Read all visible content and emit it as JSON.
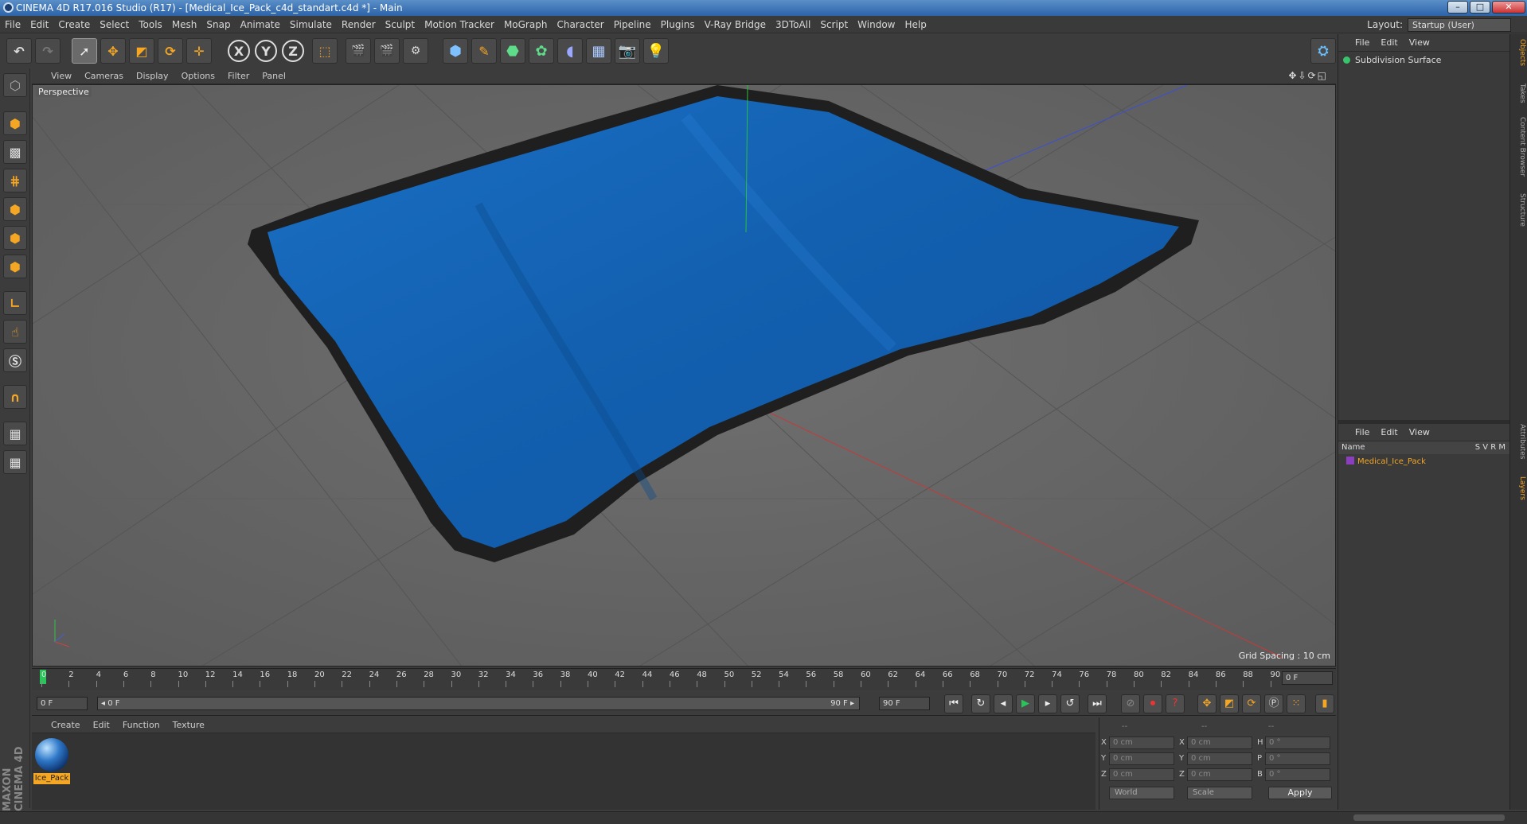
{
  "window": {
    "title": "CINEMA 4D R17.016 Studio (R17) - [Medical_Ice_Pack_c4d_standart.c4d *] - Main",
    "minimize": "–",
    "maximize": "□",
    "close": "✕"
  },
  "menubar": {
    "items": [
      "File",
      "Edit",
      "Create",
      "Select",
      "Tools",
      "Mesh",
      "Snap",
      "Animate",
      "Simulate",
      "Render",
      "Sculpt",
      "Motion Tracker",
      "MoGraph",
      "Character",
      "Pipeline",
      "Plugins",
      "V-Ray Bridge",
      "3DToAll",
      "Script",
      "Window",
      "Help"
    ],
    "layout_label": "Layout:",
    "layout_value": "Startup (User)"
  },
  "toolbar": {
    "undo": "↶",
    "redo": "↷",
    "x_axis": "X",
    "y_axis": "Y",
    "z_axis": "Z"
  },
  "viewport": {
    "menu": [
      "View",
      "Cameras",
      "Display",
      "Options",
      "Filter",
      "Panel"
    ],
    "label": "Perspective",
    "grid_spacing": "Grid Spacing : 10 cm",
    "nav_icons": "✥⇩⟳◱",
    "object_color": "#1565b8",
    "border_color": "#1e1e1e"
  },
  "timeline": {
    "ticks": [
      "0",
      "2",
      "4",
      "6",
      "8",
      "10",
      "12",
      "14",
      "16",
      "18",
      "20",
      "22",
      "24",
      "26",
      "28",
      "30",
      "32",
      "34",
      "36",
      "38",
      "40",
      "42",
      "44",
      "46",
      "48",
      "50",
      "52",
      "54",
      "56",
      "58",
      "60",
      "62",
      "64",
      "66",
      "68",
      "70",
      "72",
      "74",
      "76",
      "78",
      "80",
      "82",
      "84",
      "86",
      "88",
      "90"
    ],
    "frame_end_field": "0 F"
  },
  "transport": {
    "current": "0 F",
    "range_start": "◂ 0 F",
    "range_end": "90 F ▸",
    "max": "90 F"
  },
  "materials": {
    "menu": [
      "Create",
      "Edit",
      "Function",
      "Texture"
    ],
    "items": [
      {
        "name": "Ice_Pack"
      }
    ]
  },
  "coordinates": {
    "header": [
      "--",
      "--",
      "--"
    ],
    "rows": [
      {
        "a": "X",
        "av": "0 cm",
        "b": "X",
        "bv": "0 cm",
        "c": "H",
        "cv": "0 °"
      },
      {
        "a": "Y",
        "av": "0 cm",
        "b": "Y",
        "bv": "0 cm",
        "c": "P",
        "cv": "0 °"
      },
      {
        "a": "Z",
        "av": "0 cm",
        "b": "Z",
        "bv": "0 cm",
        "c": "B",
        "cv": "0 °"
      }
    ],
    "space": "World",
    "mode": "Scale",
    "apply": "Apply"
  },
  "objects_panel": {
    "menu": [
      "File",
      "Edit",
      "View"
    ],
    "object": "Subdivision Surface"
  },
  "layers_panel": {
    "menu": [
      "File",
      "Edit",
      "View"
    ],
    "columns": "Name",
    "col_flags": "S  V  R  M",
    "layer": "Medical_Ice_Pack"
  },
  "right_tabs": [
    "Objects",
    "Takes",
    "Content Browser",
    "Structure",
    "Attributes",
    "Layers"
  ],
  "brand": "MAXON CINEMA 4D"
}
